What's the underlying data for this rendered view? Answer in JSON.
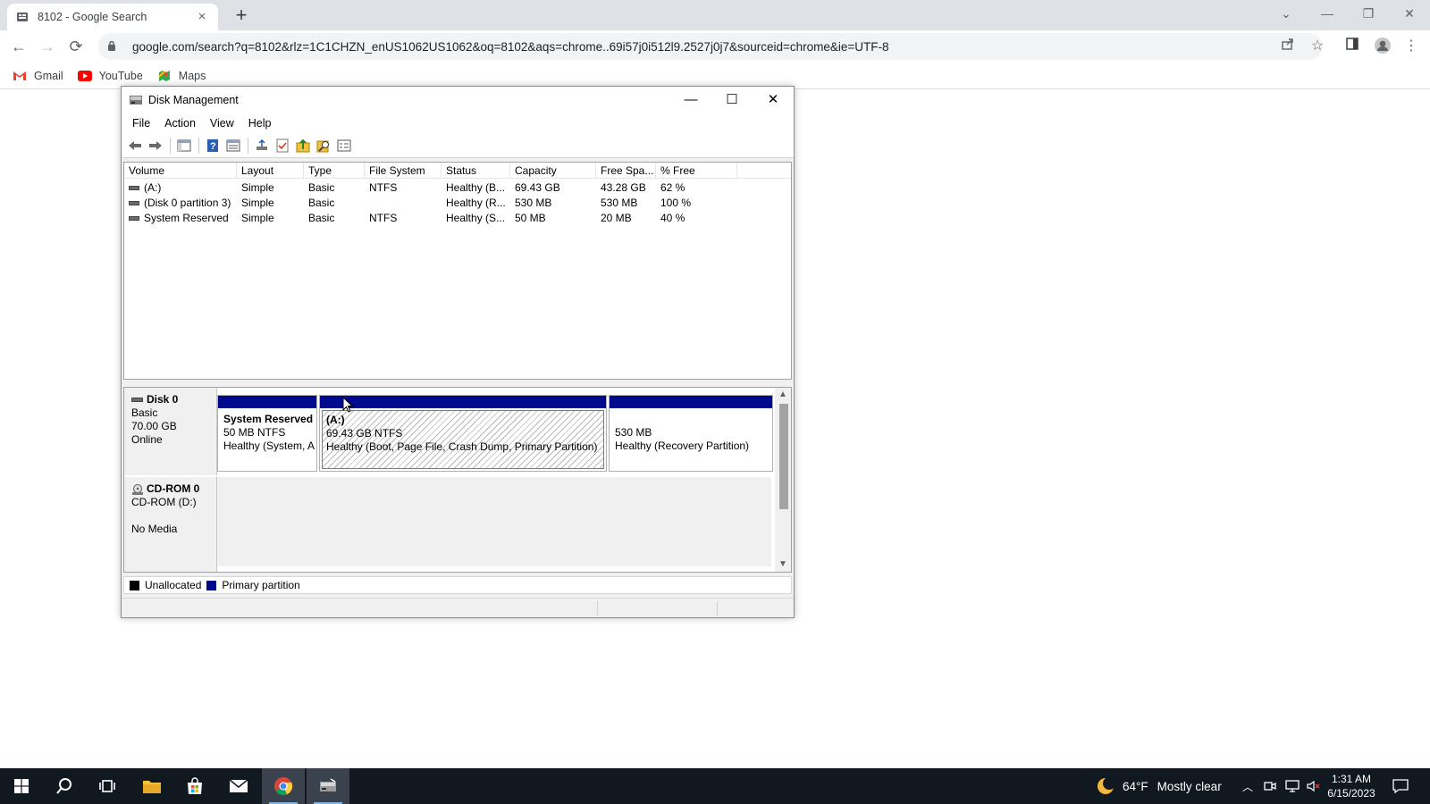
{
  "browser": {
    "tab": {
      "title": "8102 - Google Search",
      "close": "×"
    },
    "new_tab": "+",
    "window_controls": {
      "tab_search": "⌄",
      "minimize": "—",
      "restore": "❐",
      "close": "✕"
    },
    "nav": {
      "back": "←",
      "forward": "→",
      "reload": "⟳"
    },
    "url": "google.com/search?q=8102&rlz=1C1CHZN_enUS1062US1062&oq=8102&aqs=chrome..69i57j0i512l9.2527j0j7&sourceid=chrome&ie=UTF-8",
    "bookmarks": [
      {
        "label": "Gmail",
        "icon": "gmail-icon",
        "color": "#ea4335"
      },
      {
        "label": "YouTube",
        "icon": "youtube-icon",
        "color": "#ff0000"
      },
      {
        "label": "Maps",
        "icon": "maps-icon",
        "color": "#34a853"
      }
    ]
  },
  "disk_management": {
    "title": "Disk Management",
    "window_controls": {
      "minimize": "—",
      "maximize": "☐",
      "close": "✕"
    },
    "menu": [
      "File",
      "Action",
      "View",
      "Help"
    ],
    "toolbar_icons": [
      "back-arrow-icon",
      "forward-arrow-icon",
      "console-tree-icon",
      "help-icon",
      "properties-icon",
      "connect-icon",
      "check-icon",
      "export-icon",
      "search-icon",
      "view-icon"
    ],
    "volume_columns": [
      "Volume",
      "Layout",
      "Type",
      "File System",
      "Status",
      "Capacity",
      "Free Spa...",
      "% Free"
    ],
    "volumes": [
      [
        "(A:)",
        "Simple",
        "Basic",
        "NTFS",
        "Healthy (B...",
        "69.43 GB",
        "43.28 GB",
        "62 %"
      ],
      [
        "(Disk 0 partition 3)",
        "Simple",
        "Basic",
        "",
        "Healthy (R...",
        "530 MB",
        "530 MB",
        "100 %"
      ],
      [
        "System Reserved",
        "Simple",
        "Basic",
        "NTFS",
        "Healthy (S...",
        "50 MB",
        "20 MB",
        "40 %"
      ]
    ],
    "disk0": {
      "name": "Disk 0",
      "type": "Basic",
      "size": "70.00 GB",
      "state": "Online",
      "partitions": [
        {
          "name": "System Reserved",
          "size": "50 MB NTFS",
          "status": "Healthy (System, A"
        },
        {
          "name": "(A:)",
          "size": "69.43 GB NTFS",
          "status": "Healthy (Boot, Page File, Crash Dump, Primary Partition)"
        },
        {
          "name": "",
          "size": "530 MB",
          "status": "Healthy (Recovery Partition)"
        }
      ]
    },
    "cdrom0": {
      "name": "CD-ROM 0",
      "drive": "CD-ROM (D:)",
      "media": "No Media"
    },
    "legend": [
      {
        "label": "Unallocated",
        "color": "#000000"
      },
      {
        "label": "Primary partition",
        "color": "#000a8c"
      }
    ]
  },
  "taskbar": {
    "weather": {
      "temp": "64°F",
      "condition": "Mostly clear"
    },
    "clock": {
      "time": "1:31 AM",
      "date": "6/15/2023"
    },
    "accent": "#7fb4e6"
  }
}
